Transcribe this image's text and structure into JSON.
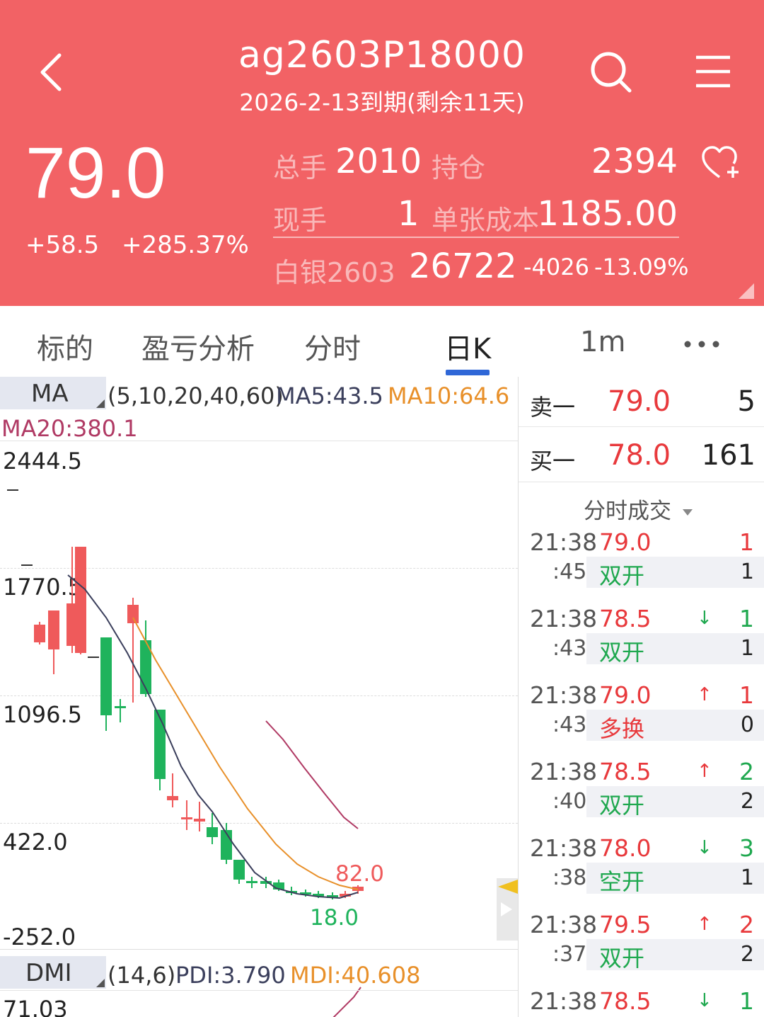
{
  "header": {
    "title": "ag2603P18000",
    "subtitle": "2026-2-13到期(剩余11天)",
    "price": "79.0",
    "change": "+58.5",
    "change_pct": "+285.37%",
    "total_volume_label": "总手",
    "total_volume": "2010",
    "open_interest_label": "持仓",
    "open_interest": "2394",
    "current_volume_label": "现手",
    "current_volume": "1",
    "unit_cost_label": "单张成本",
    "unit_cost": "1185.00",
    "underlying_label": "白银2603",
    "underlying_price": "26722",
    "underlying_change": "-4026",
    "underlying_change_pct": "-13.09%"
  },
  "tabs": [
    {
      "label": "标的"
    },
    {
      "label": "盈亏分析"
    },
    {
      "label": "分时"
    },
    {
      "label": "日K"
    },
    {
      "label": "1m"
    }
  ],
  "chart": {
    "ma_tag": "MA",
    "ma_params": "(5,10,20,40,60)",
    "ma5": "MA5:43.5",
    "ma10": "MA10:64.6",
    "ma20": "MA20:380.1",
    "y_labels": [
      "2444.5",
      "1770.5",
      "1096.5",
      "422.0",
      "-252.0"
    ],
    "high_label": "82.0",
    "low_label": "18.0",
    "dmi_tag": "DMI",
    "dmi_params": "(14,6)",
    "pdi": "PDI:3.790",
    "mdi": "MDI:40.608",
    "dmi_top": "71.03",
    "colors": {
      "up": "#ef5a5b",
      "down": "#1fb35c",
      "ma5": "#3b3f5c",
      "ma10": "#e8902a",
      "ma20": "#b03a64"
    }
  },
  "orderbook": {
    "ask_label": "卖一",
    "ask_price": "79.0",
    "ask_volume": "5",
    "bid_label": "买一",
    "bid_price": "78.0",
    "bid_volume": "161",
    "trades_header": "分时成交"
  },
  "trades": [
    {
      "time": "21:38",
      "sec": ":45",
      "price": "79.0",
      "arrow": "",
      "vol": "1",
      "type": "双开",
      "oi": "1",
      "type_color": "#1fa84f",
      "vol_color": "#e8393c"
    },
    {
      "time": "21:38",
      "sec": ":43",
      "price": "78.5",
      "arrow": "↓",
      "vol": "1",
      "type": "双开",
      "oi": "1",
      "type_color": "#1fa84f",
      "vol_color": "#1fa84f"
    },
    {
      "time": "21:38",
      "sec": ":43",
      "price": "79.0",
      "arrow": "↑",
      "vol": "1",
      "type": "多换",
      "oi": "0",
      "type_color": "#e8393c",
      "vol_color": "#e8393c"
    },
    {
      "time": "21:38",
      "sec": ":40",
      "price": "78.5",
      "arrow": "↑",
      "vol": "2",
      "type": "双开",
      "oi": "2",
      "type_color": "#1fa84f",
      "vol_color": "#1fa84f"
    },
    {
      "time": "21:38",
      "sec": ":38",
      "price": "78.0",
      "arrow": "↓",
      "vol": "3",
      "type": "空开",
      "oi": "1",
      "type_color": "#1fa84f",
      "vol_color": "#1fa84f"
    },
    {
      "time": "21:38",
      "sec": ":37",
      "price": "79.5",
      "arrow": "↑",
      "vol": "2",
      "type": "双开",
      "oi": "2",
      "type_color": "#1fa84f",
      "vol_color": "#e8393c"
    },
    {
      "time": "21:38",
      "sec": "",
      "price": "78.5",
      "arrow": "↓",
      "vol": "1",
      "type": "",
      "oi": "",
      "type_color": "#1fa84f",
      "vol_color": "#1fa84f"
    }
  ]
}
